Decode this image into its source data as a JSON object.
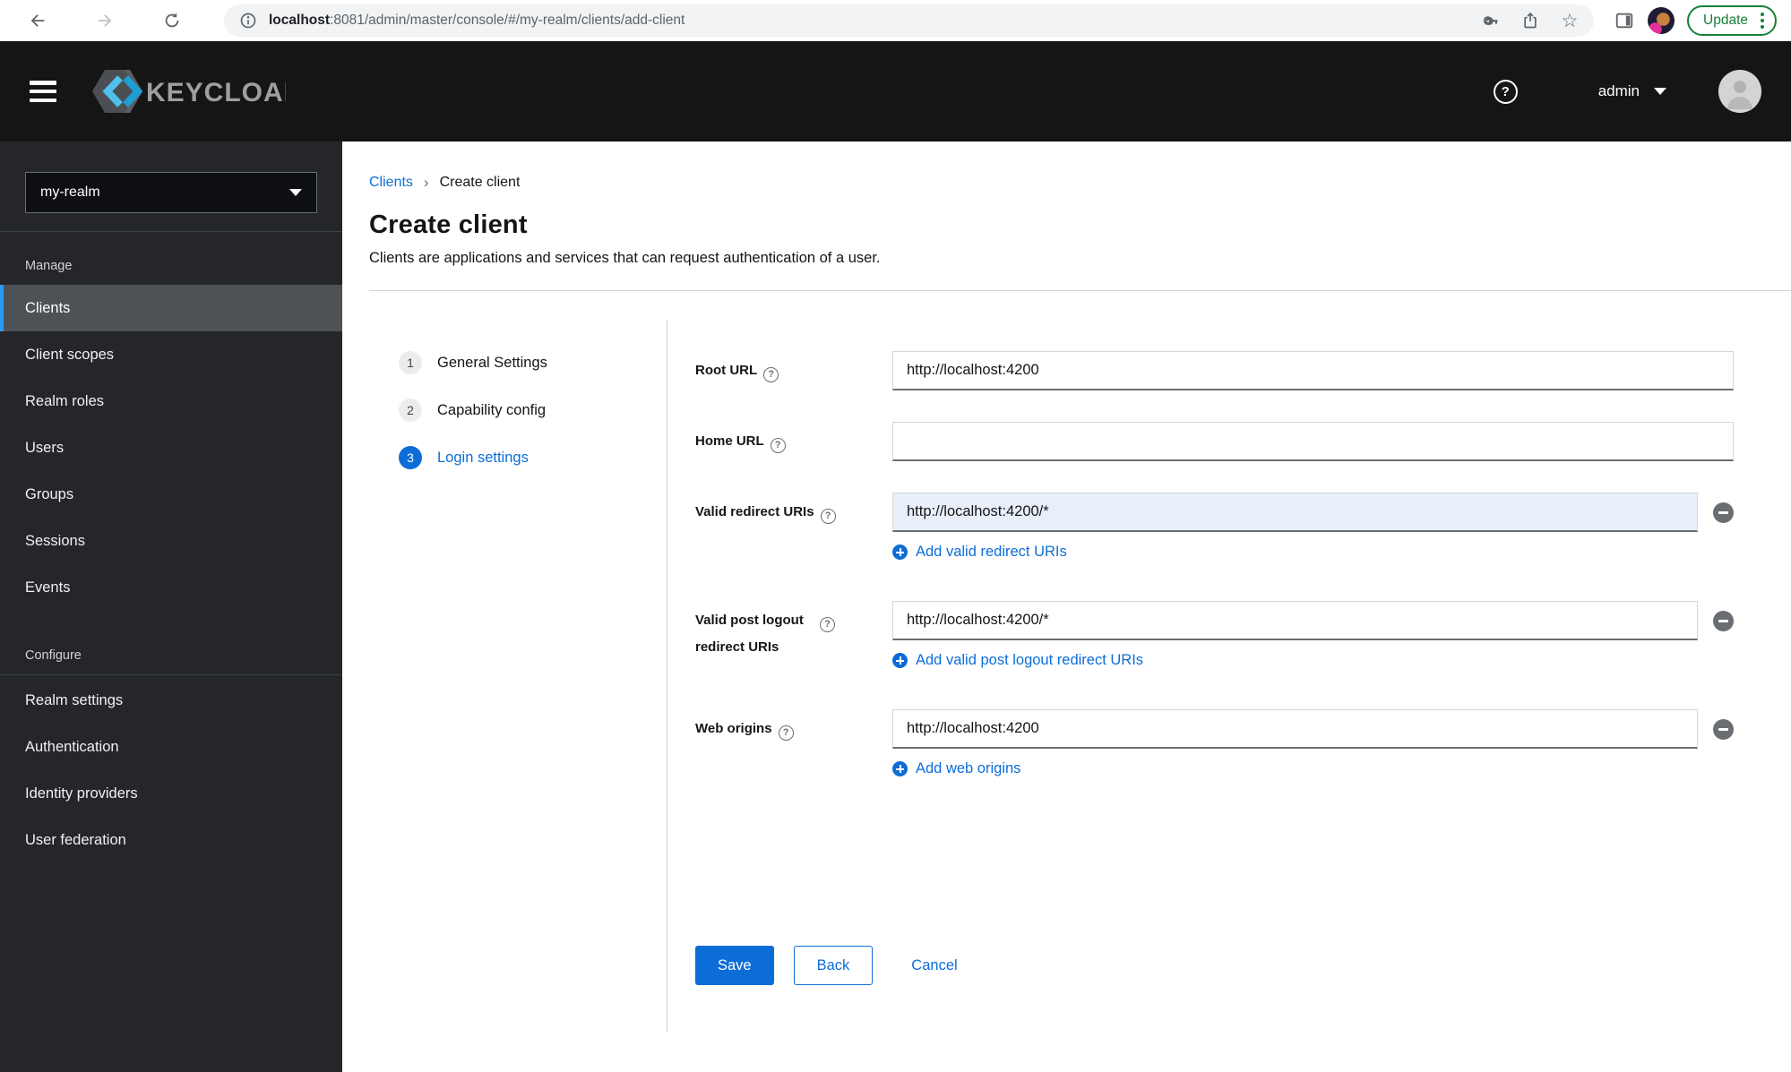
{
  "browser": {
    "url_host": "localhost",
    "url_rest": ":8081/admin/master/console/#/my-realm/clients/add-client",
    "update_label": "Update"
  },
  "header": {
    "brand": "KEYCLOAK",
    "username": "admin"
  },
  "sidebar": {
    "realm": "my-realm",
    "sections": [
      {
        "label": "Manage",
        "items": [
          "Clients",
          "Client scopes",
          "Realm roles",
          "Users",
          "Groups",
          "Sessions",
          "Events"
        ],
        "active_item": "Clients"
      },
      {
        "label": "Configure",
        "items": [
          "Realm settings",
          "Authentication",
          "Identity providers",
          "User federation"
        ]
      }
    ]
  },
  "breadcrumb": {
    "parent": "Clients",
    "current": "Create client"
  },
  "page": {
    "title": "Create client",
    "subtitle": "Clients are applications and services that can request authentication of a user."
  },
  "wizard": {
    "steps": [
      {
        "num": "1",
        "label": "General Settings",
        "active": false
      },
      {
        "num": "2",
        "label": "Capability config",
        "active": false
      },
      {
        "num": "3",
        "label": "Login settings",
        "active": true
      }
    ]
  },
  "form": {
    "root_url": {
      "label": "Root URL",
      "value": "http://localhost:4200"
    },
    "home_url": {
      "label": "Home URL",
      "value": ""
    },
    "redirect_uris": {
      "label": "Valid redirect URIs",
      "value": "http://localhost:4200/*",
      "add_label": "Add valid redirect URIs"
    },
    "post_logout": {
      "label": "Valid post logout redirect URIs",
      "value": "http://localhost:4200/*",
      "add_label": "Add valid post logout redirect URIs"
    },
    "web_origins": {
      "label": "Web origins",
      "value": "http://localhost:4200",
      "add_label": "Add web origins"
    }
  },
  "actions": {
    "save": "Save",
    "back": "Back",
    "cancel": "Cancel"
  },
  "colors": {
    "accent_blue": "#0d6dd8",
    "nav_active_indicator": "#2b9af3",
    "masthead_bg": "#151515",
    "sidebar_bg": "#24262a",
    "nav_active_bg": "#4f5255",
    "highlighted_input_bg": "#e8effb",
    "chrome_update_green": "#188038",
    "input_bottom_border": "#6a6e73",
    "divider": "#d2d2d2"
  }
}
